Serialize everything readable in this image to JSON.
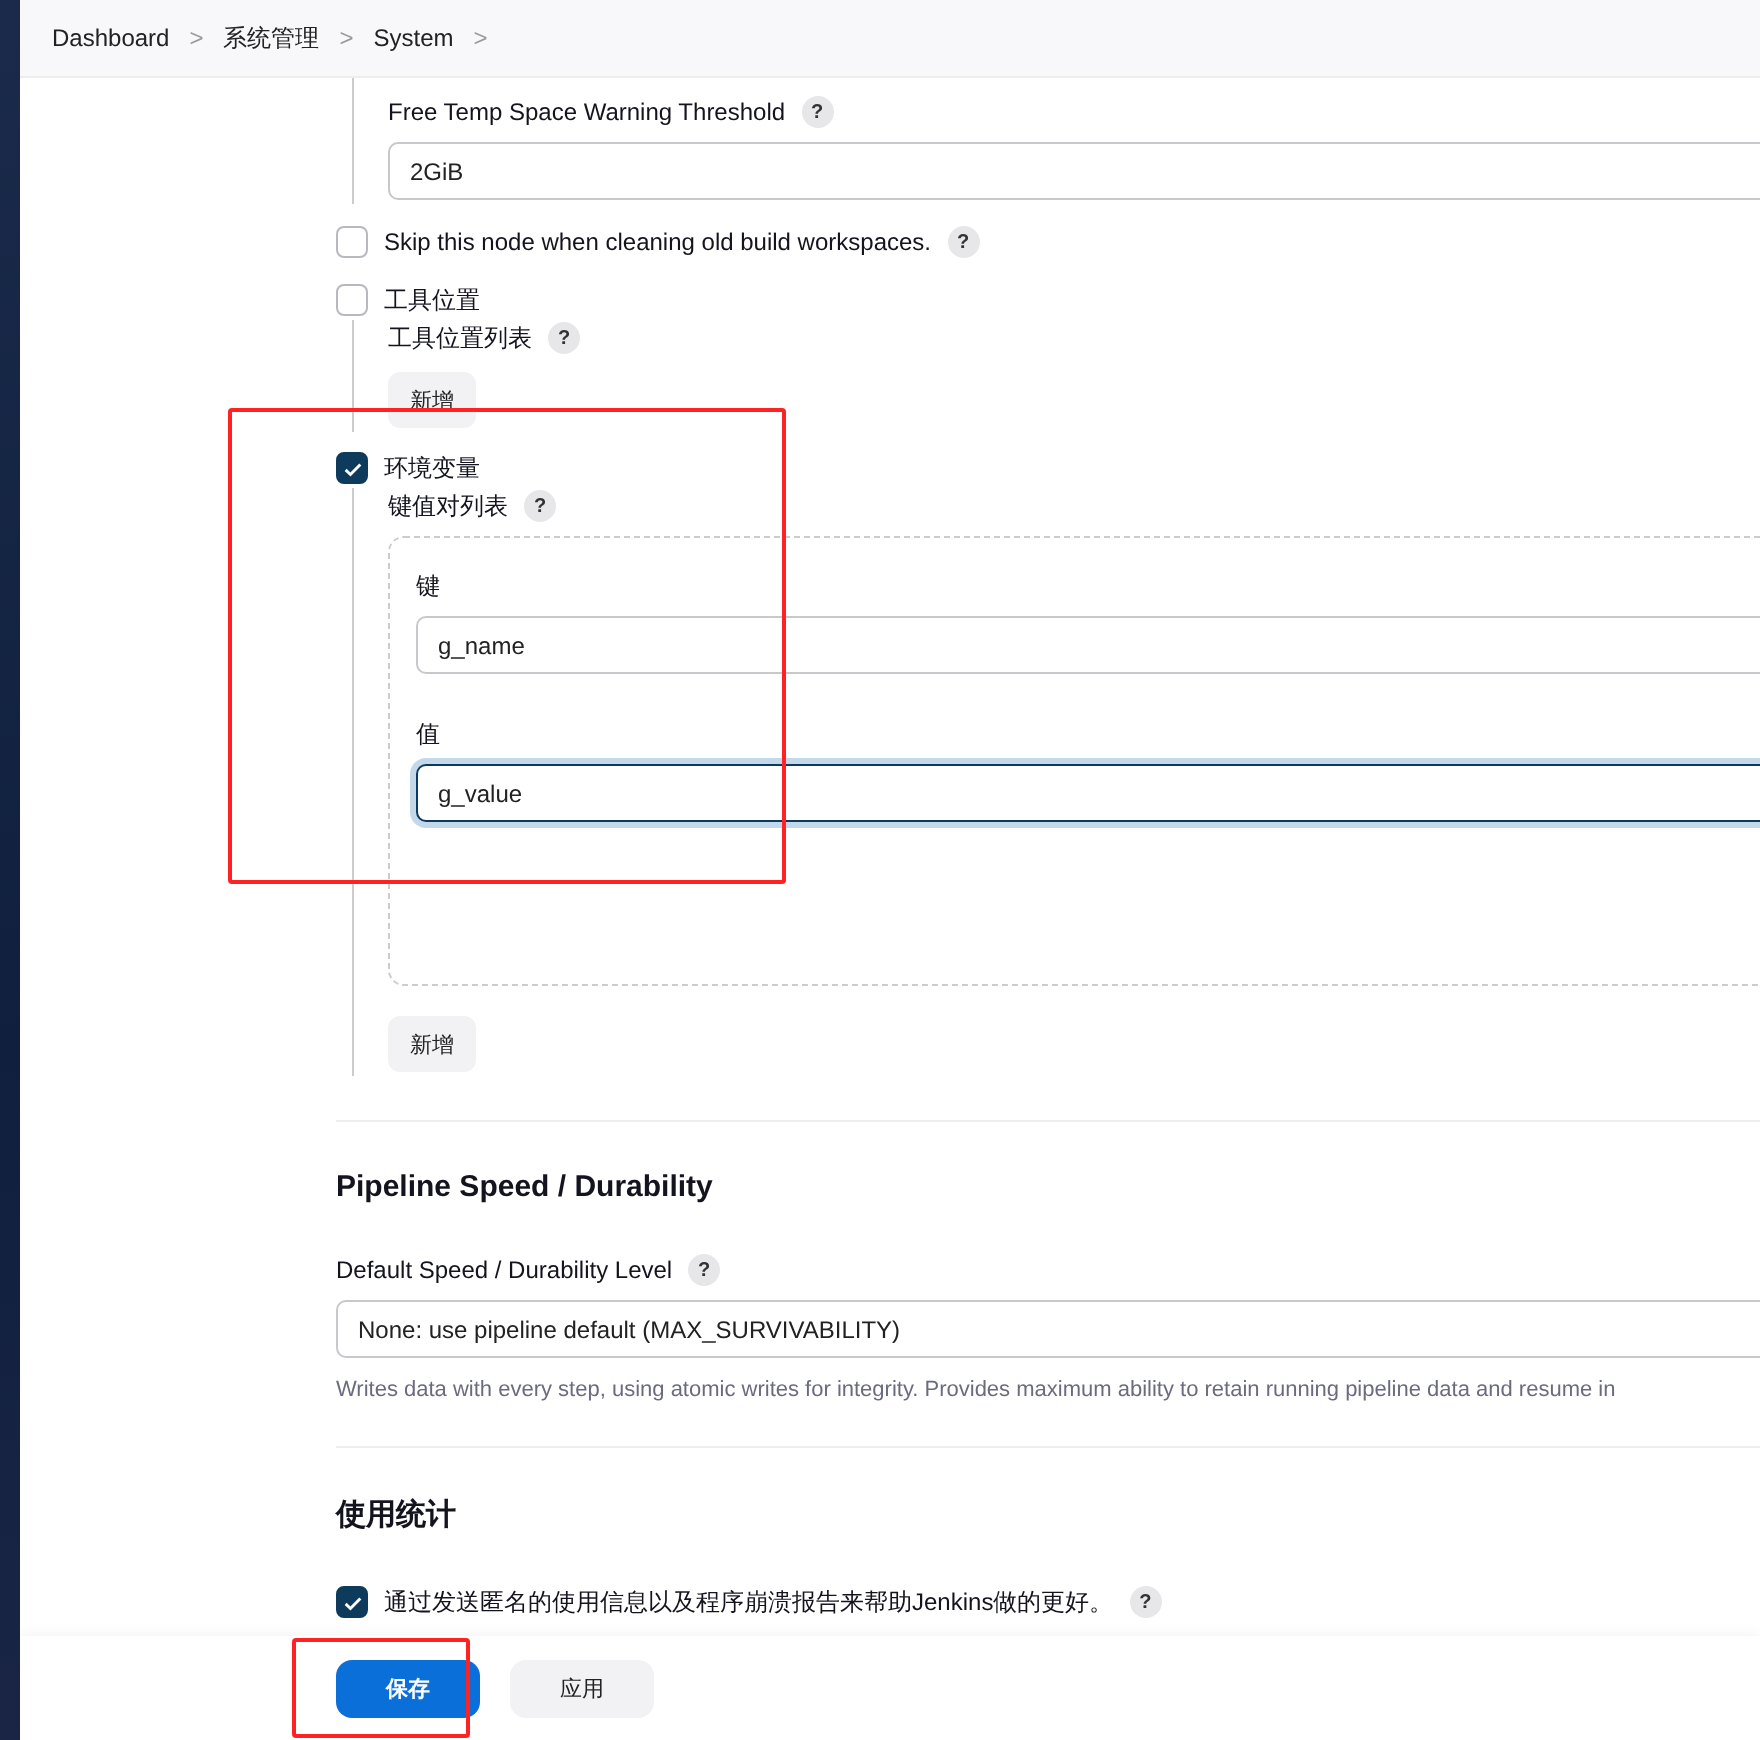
{
  "breadcrumbs": [
    {
      "label": "Dashboard"
    },
    {
      "label": "系统管理"
    },
    {
      "label": "System"
    }
  ],
  "breadcrumb_separator": ">",
  "temp_space": {
    "label": "Free Temp Space Warning Threshold",
    "help": "?",
    "value": "2GiB"
  },
  "skip_node": {
    "label": "Skip this node when cleaning old build workspaces.",
    "help": "?",
    "checked": false
  },
  "tool_locations": {
    "label": "工具位置",
    "checked": false,
    "list_label": "工具位置列表",
    "help": "?",
    "add_button": "新增"
  },
  "env_vars": {
    "label": "环境变量",
    "checked": true,
    "list_label": "键值对列表",
    "help": "?",
    "entries": [
      {
        "key_label": "键",
        "key": "g_name",
        "value_label": "值",
        "value": "g_value",
        "focused": true
      }
    ],
    "add_button": "新增"
  },
  "pipeline": {
    "heading": "Pipeline Speed / Durability",
    "label": "Default Speed / Durability Level",
    "help": "?",
    "value": "None: use pipeline default (MAX_SURVIVABILITY)",
    "description": "Writes data with every step, using atomic writes for integrity.  Provides maximum ability to retain running pipeline data and resume in"
  },
  "usage": {
    "heading": "使用统计",
    "label": "通过发送匿名的使用信息以及程序崩溃报告来帮助Jenkins做的更好。",
    "help": "?",
    "checked": true
  },
  "buttons": [
    {
      "label": "保存",
      "kind": "primary"
    },
    {
      "label": "应用",
      "kind": "secondary"
    }
  ]
}
